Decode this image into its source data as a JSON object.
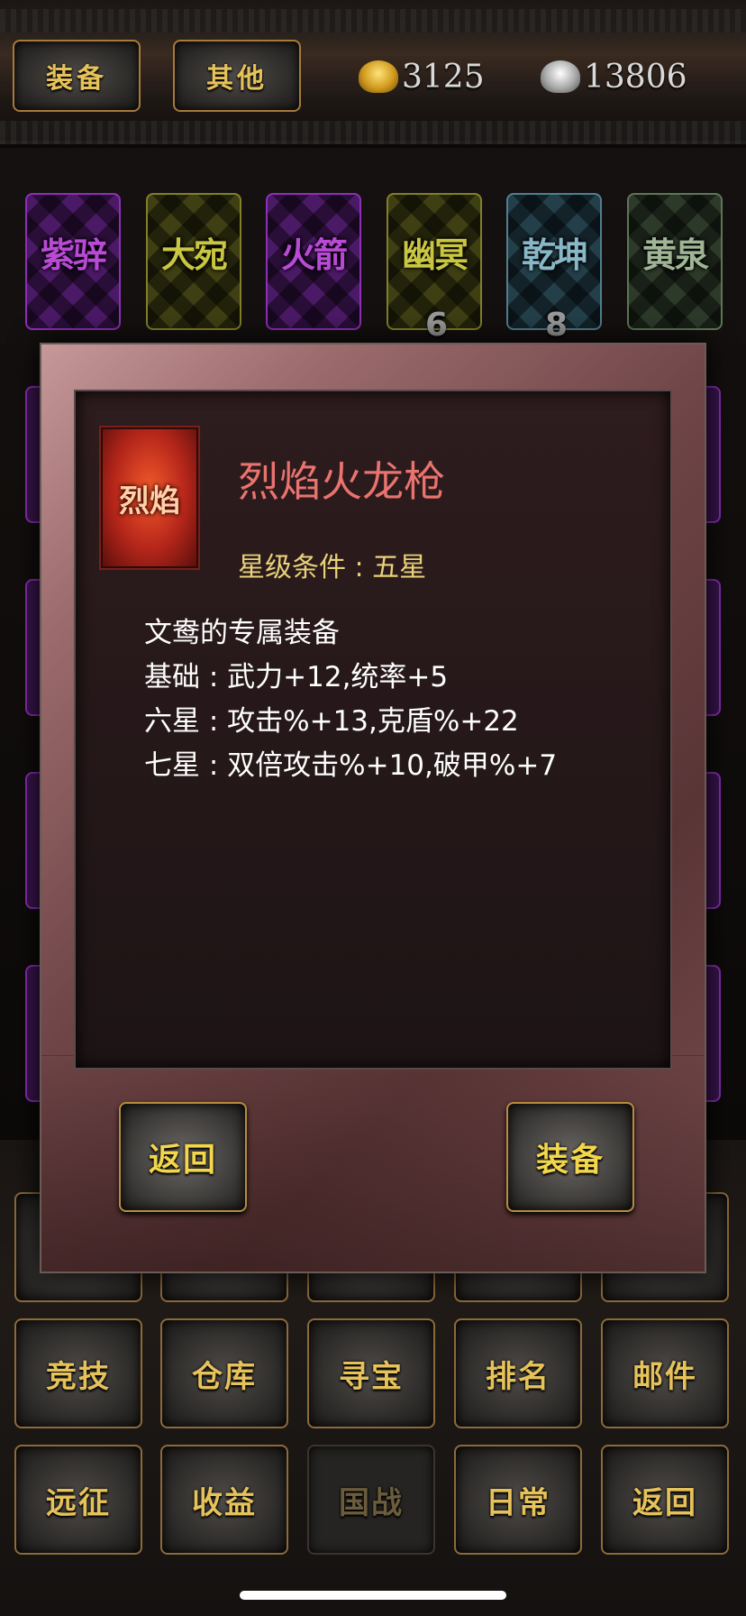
{
  "header": {
    "tabs": [
      {
        "label": "装备"
      },
      {
        "label": "其他"
      }
    ],
    "gold": "3125",
    "silver": "13806"
  },
  "cards": [
    {
      "name": "紫骍",
      "color": "#b94ad6"
    },
    {
      "name": "大宛",
      "color": "#c9c641"
    },
    {
      "name": "火箭",
      "color": "#b94ad6"
    },
    {
      "name": "幽冥",
      "color": "#c9c641",
      "count": "6"
    },
    {
      "name": "乾坤",
      "color": "#88b8c8",
      "count": "8"
    },
    {
      "name": "黄泉",
      "color": "#9fb595"
    }
  ],
  "menu": {
    "row1": [
      "竞技",
      "仓库",
      "寻宝",
      "排名",
      "邮件"
    ],
    "row2": [
      "远征",
      "收益",
      "国战",
      "日常",
      "返回"
    ]
  },
  "modal": {
    "icon_text": "烈焰",
    "item_name": "烈焰火龙枪",
    "star_condition": "星级条件 : 五星",
    "description": [
      "文鸯的专属装备",
      "基础 : 武力+12,统率+5",
      "六星 : 攻击%+13,克盾%+22",
      "七星 : 双倍攻击%+10,破甲%+7"
    ],
    "back_label": "返回",
    "equip_label": "装备"
  }
}
